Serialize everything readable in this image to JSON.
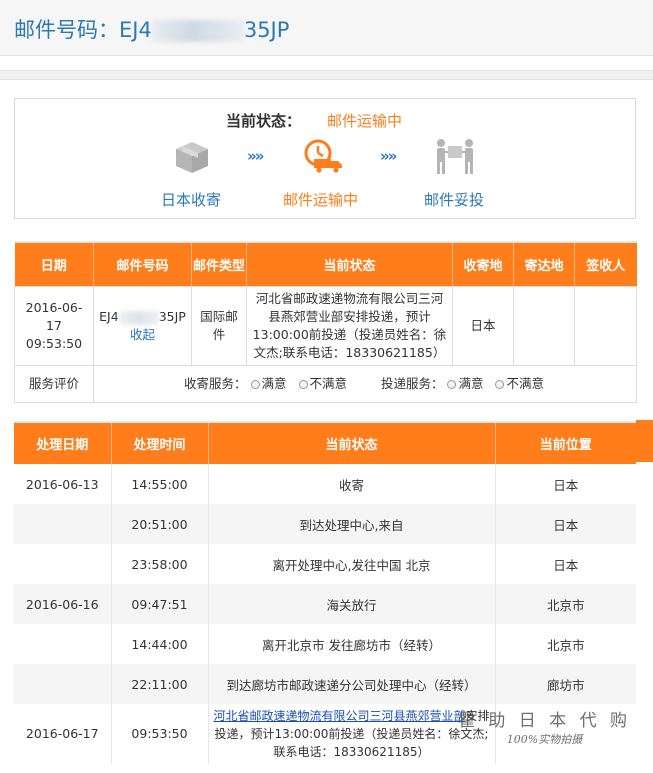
{
  "header": {
    "label": "邮件号码：",
    "number_prefix": "EJ4",
    "number_suffix": "35JP"
  },
  "status": {
    "current_label": "当前状态：",
    "current_value": "邮件运输中",
    "steps": [
      {
        "label": "日本收寄",
        "icon": "package-box-icon",
        "state": "done"
      },
      {
        "label": "邮件运输中",
        "icon": "delivery-truck-clock-icon",
        "state": "active"
      },
      {
        "label": "邮件妥投",
        "icon": "handover-people-icon",
        "state": "pending"
      }
    ],
    "arrow_glyph": "»»",
    "colors": {
      "active": "#ff7d1a",
      "done": "#2b78b8",
      "pending": "#2b78b8",
      "icon_gray": "#b5b5b5"
    }
  },
  "mail_table": {
    "headers": [
      "日期",
      "邮件号码",
      "邮件类型",
      "当前状态",
      "收寄地",
      "寄达地",
      "签收人"
    ],
    "row": {
      "date": "2016-06-17 09:53:50",
      "number_prefix": "EJ4",
      "number_suffix": "35JP",
      "collapse_link": "收起",
      "type": "国际邮件",
      "status": "河北省邮政速递物流有限公司三河县燕郊营业部安排投递，预计13:00:00前投递（投递员姓名：徐文杰;联系电话：18330621185）",
      "origin": "日本",
      "destination": "",
      "signer": ""
    },
    "rating": {
      "label": "服务评价",
      "collect_label": "收寄服务：",
      "deliver_label": "投递服务：",
      "satisfied": "满意",
      "unsatisfied": "不满意"
    }
  },
  "track_table": {
    "headers": [
      "处理日期",
      "处理时间",
      "当前状态",
      "当前位置"
    ],
    "rows": [
      {
        "date": "2016-06-13",
        "time": "14:55:00",
        "status": "收寄",
        "location": "日本"
      },
      {
        "date": "",
        "time": "20:51:00",
        "status": "到达处理中心,来自",
        "location": "日本"
      },
      {
        "date": "",
        "time": "23:58:00",
        "status": "离开处理中心,发往中国 北京",
        "location": "日本"
      },
      {
        "date": "2016-06-16",
        "time": "09:47:51",
        "status": "海关放行",
        "location": "北京市"
      },
      {
        "date": "",
        "time": "14:44:00",
        "status": "离开北京市 发往廊坊市（经转）",
        "location": "北京市"
      },
      {
        "date": "",
        "time": "22:11:00",
        "status": "到达廊坊市邮政速递分公司处理中心（经转）",
        "location": "廊坊市"
      },
      {
        "date": "2016-06-17",
        "time": "09:53:50",
        "status_link": "河北省邮政速递物流有限公司三河县燕郊营业部",
        "status_rest": "安排投递，预计13:00:00前投递（投递员姓名：徐文杰;联系电话：18330621185）",
        "location": ""
      }
    ]
  },
  "watermark": {
    "line1": "瞿 助 日 本 代 购",
    "line2": "100%实物拍摄"
  }
}
